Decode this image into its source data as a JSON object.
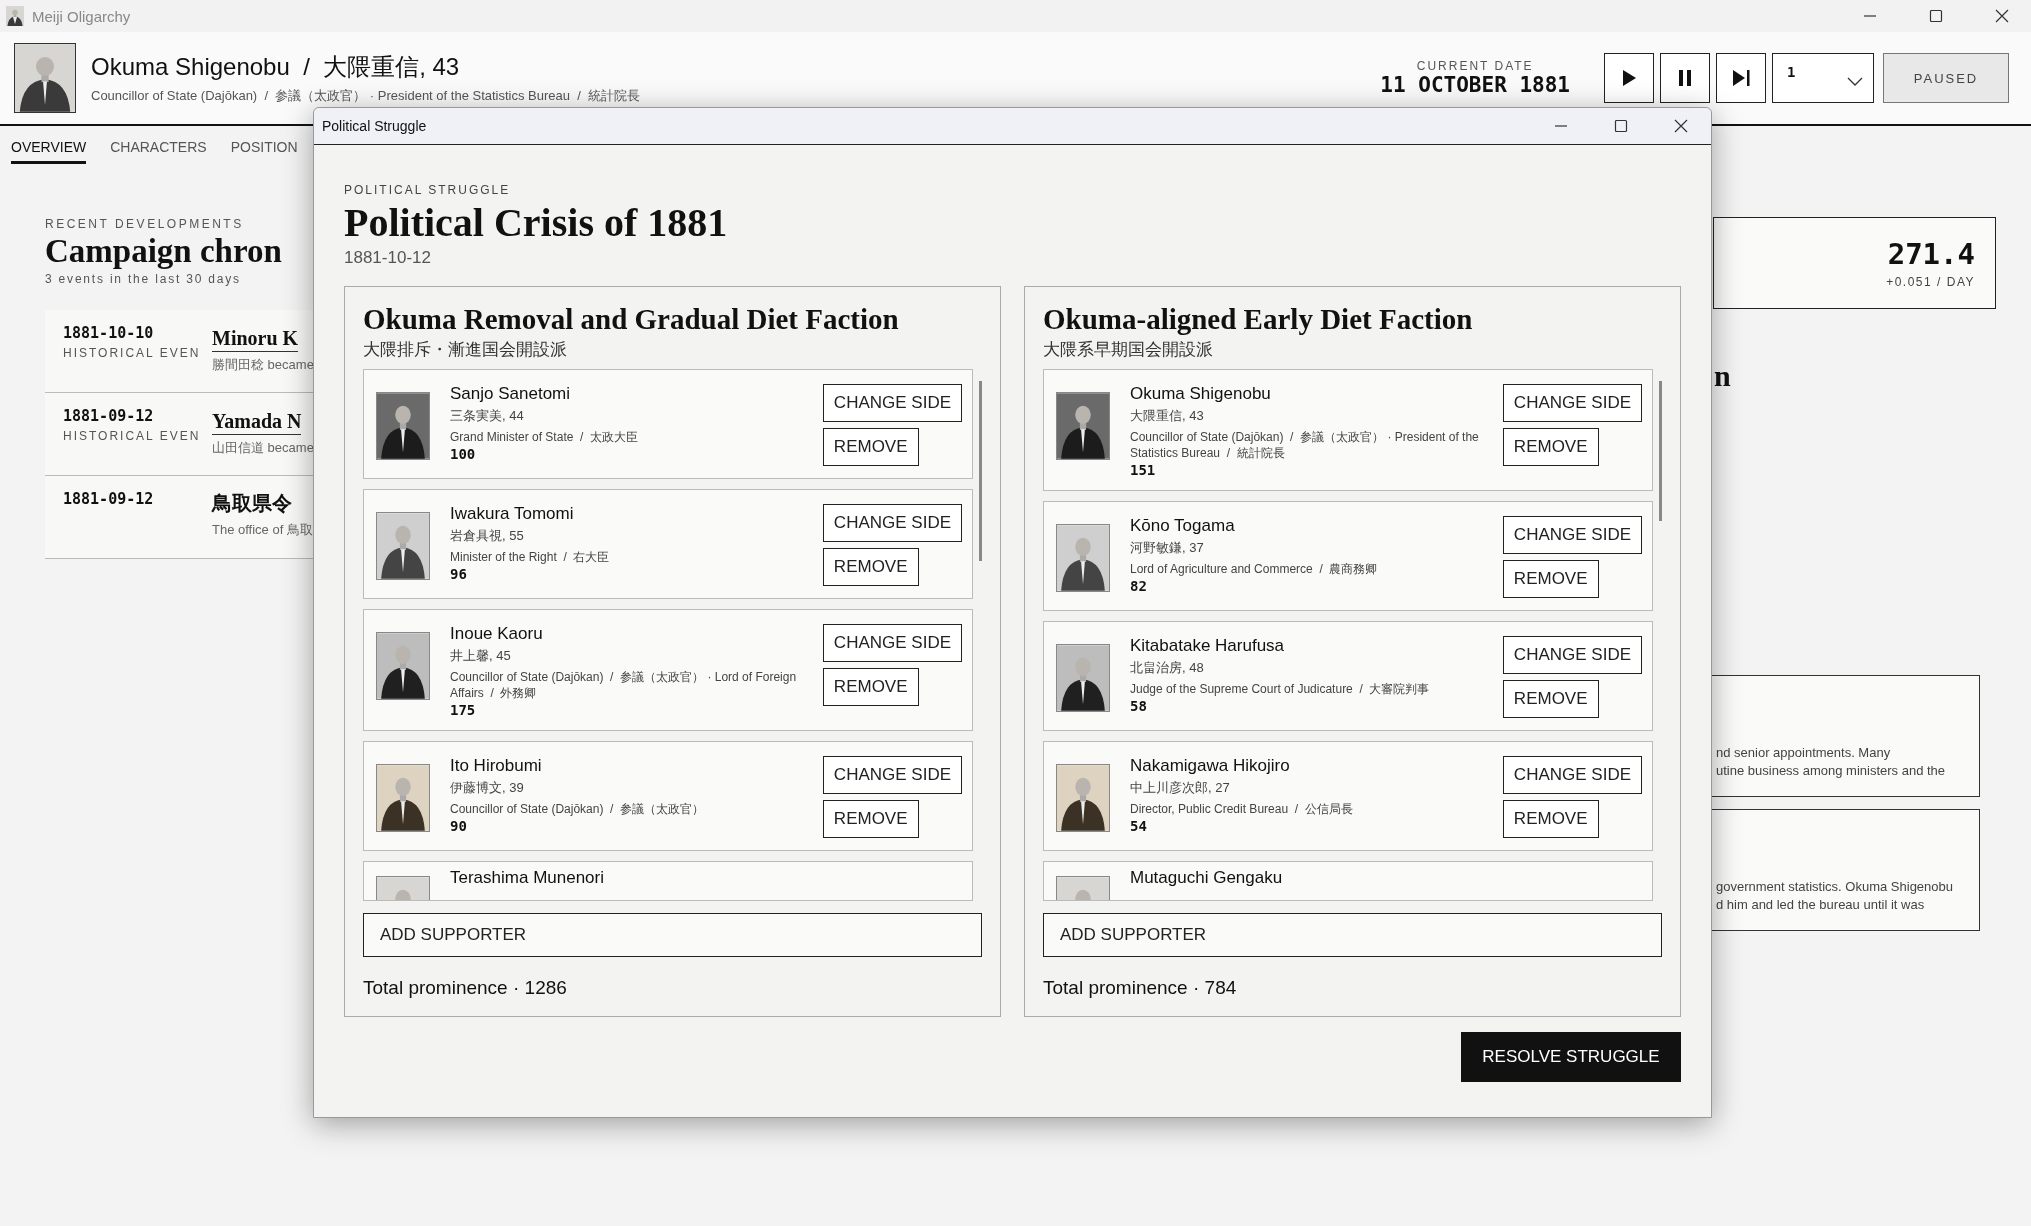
{
  "window": {
    "title": "Meiji Oligarchy"
  },
  "header": {
    "name": "Okuma Shigenobu  /  大隈重信, 43",
    "subtitle": "Councillor of State (Dajōkan)  /  参議（太政官） · President of the Statistics Bureau  /  統計院長",
    "date_label": "CURRENT DATE",
    "date": "11 OCTOBER 1881",
    "speed": "1",
    "status": "PAUSED"
  },
  "tabs": [
    {
      "label": "OVERVIEW",
      "selected": true
    },
    {
      "label": "CHARACTERS",
      "selected": false
    },
    {
      "label": "POSITION",
      "selected": false
    }
  ],
  "recent": {
    "eyebrow": "RECENT DEVELOPMENTS",
    "title": "Campaign chron",
    "count": "3 events in the last 30 days",
    "events": [
      {
        "date": "1881-10-10",
        "type": "HISTORICAL EVEN",
        "title": "Minoru K",
        "linked": true,
        "text": "勝間田稔 became"
      },
      {
        "date": "1881-09-12",
        "type": "HISTORICAL EVEN",
        "title": "Yamada N",
        "linked": true,
        "text": "山田信道 became"
      },
      {
        "date": "1881-09-12",
        "title": "鳥取県令",
        "linked": false,
        "text": "The office of 鳥取"
      }
    ]
  },
  "side": {
    "value": "271.4",
    "rate": "+0.051 / DAY",
    "heading": "n",
    "cards": [
      {
        "lines": [
          "nd senior appointments. Many",
          "utine business among ministers and the"
        ]
      },
      {
        "lines": [
          "government statistics. Okuma Shigenobu",
          "d him and led the bureau until it was"
        ]
      }
    ]
  },
  "dialog": {
    "title": "Political Struggle",
    "eyebrow": "POLITICAL STRUGGLE",
    "heading": "Political Crisis of 1881",
    "date": "1881-10-12",
    "factions": [
      {
        "name": "Okuma Removal and Gradual Diet Faction",
        "native": "大隈排斥・漸進国会開設派",
        "total": "Total prominence · 1286",
        "add": "ADD SUPPORTER",
        "supporters": [
          {
            "name": "Sanjo Sanetomi",
            "native": "三条実美, 44",
            "offices": "Grand Minister of State  /  太政大臣",
            "prominence": "100",
            "change": "CHANGE SIDE",
            "remove": "REMOVE"
          },
          {
            "name": "Iwakura Tomomi",
            "native": "岩倉具視, 55",
            "offices": "Minister of the Right  /  右大臣",
            "prominence": "96",
            "change": "CHANGE SIDE",
            "remove": "REMOVE"
          },
          {
            "name": "Inoue Kaoru",
            "native": "井上馨, 45",
            "offices": "Councillor of State (Dajōkan)  /  参議（太政官） · Lord of Foreign Affairs  /  外務卿",
            "prominence": "175",
            "change": "CHANGE SIDE",
            "remove": "REMOVE"
          },
          {
            "name": "Ito Hirobumi",
            "native": "伊藤博文, 39",
            "offices": "Councillor of State (Dajōkan)  /  参議（太政官）",
            "prominence": "90",
            "change": "CHANGE SIDE",
            "remove": "REMOVE"
          },
          {
            "name": "Terashima Munenori",
            "partial": true
          }
        ]
      },
      {
        "name": "Okuma-aligned Early Diet Faction",
        "native": "大隈系早期国会開設派",
        "total": "Total prominence · 784",
        "add": "ADD SUPPORTER",
        "supporters": [
          {
            "name": "Okuma Shigenobu",
            "native": "大隈重信, 43",
            "offices": "Councillor of State (Dajōkan)  /  参議（太政官） · President of the Statistics Bureau  /  統計院長",
            "prominence": "151",
            "change": "CHANGE SIDE",
            "remove": "REMOVE"
          },
          {
            "name": "Kōno Togama",
            "native": "河野敏鎌, 37",
            "offices": "Lord of Agriculture and Commerce  /  農商務卿",
            "prominence": "82",
            "change": "CHANGE SIDE",
            "remove": "REMOVE"
          },
          {
            "name": "Kitabatake Harufusa",
            "native": "北畠治房, 48",
            "offices": "Judge of the Supreme Court of Judicature  /  大審院判事",
            "prominence": "58",
            "change": "CHANGE SIDE",
            "remove": "REMOVE"
          },
          {
            "name": "Nakamigawa Hikojiro",
            "native": "中上川彦次郎, 27",
            "offices": "Director, Public Credit Bureau  /  公信局長",
            "prominence": "54",
            "change": "CHANGE SIDE",
            "remove": "REMOVE"
          },
          {
            "name": "Mutaguchi Gengaku",
            "partial": true
          }
        ]
      }
    ],
    "resolve": "RESOLVE STRUGGLE"
  }
}
